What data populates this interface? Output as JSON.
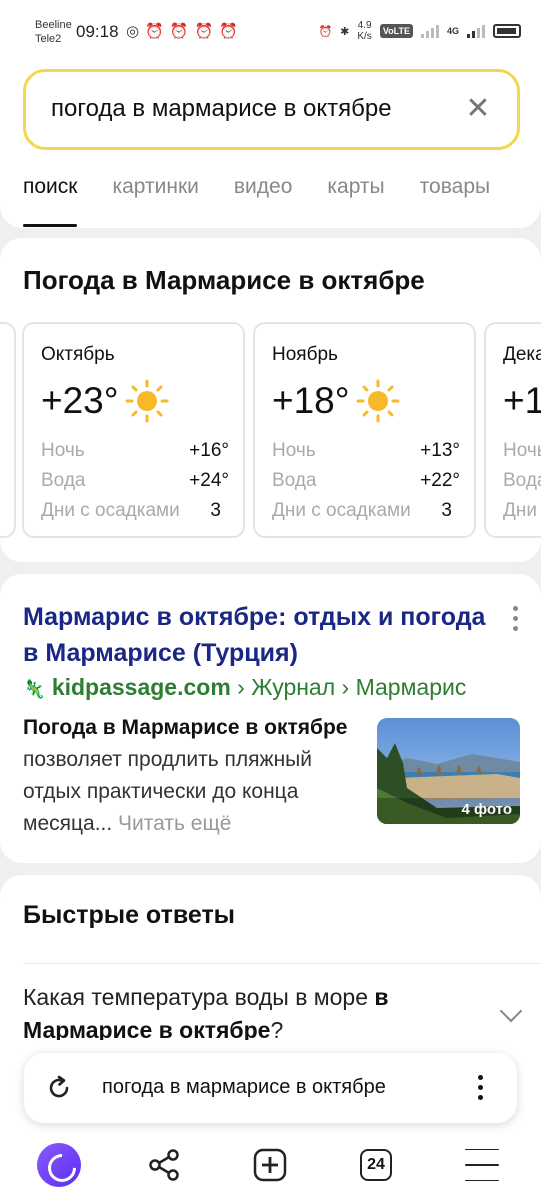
{
  "status": {
    "carrier1": "Beeline",
    "carrier2": "Tele2",
    "time": "09:18",
    "speed_value": "4.9",
    "speed_unit": "K/s",
    "volte": "VoLTE",
    "network": "4G",
    "icons_left": [
      "instagram-icon",
      "alarm-icon",
      "alarm-icon",
      "alarm-icon",
      "alarm-icon"
    ]
  },
  "search": {
    "query": "погода в мармарисе в октябре",
    "tabs": [
      "поиск",
      "картинки",
      "видео",
      "карты",
      "товары"
    ]
  },
  "weather": {
    "title": "Погода в Мармарисе в октябре",
    "labels": {
      "night": "Ночь",
      "water": "Вода",
      "rain_days": "Дни с осадками"
    },
    "cards": [
      {
        "month": "Октябрь",
        "temp": "+23°",
        "night": "+16°",
        "water": "+24°",
        "rain_days": "3"
      },
      {
        "month": "Ноябрь",
        "temp": "+18°",
        "night": "+13°",
        "water": "+22°",
        "rain_days": "3"
      },
      {
        "month": "Декабрь",
        "temp": "+1",
        "night": "",
        "water": "",
        "rain_days": ""
      }
    ]
  },
  "result": {
    "title": "Мармарис в октябре: отдых и погода в Мармарисе (Турция)",
    "domain": "kidpassage.com",
    "path": " › Журнал › Мармарис",
    "snippet_highlight": "Погода в Мармарисе в октябре",
    "snippet_rest": " позволяет продлить пляжный отдых практически до конца месяца...",
    "read_more": " Читать ещё",
    "photo_count": "4 фото"
  },
  "quick": {
    "title": "Быстрые ответы",
    "question_start": "Какая температура воды в море ",
    "question_bold": "в Мармарисе в октябре",
    "question_end": "?"
  },
  "bottom": {
    "omnibox_text": "погода в мармарисе в октябре",
    "tab_count": "24"
  }
}
